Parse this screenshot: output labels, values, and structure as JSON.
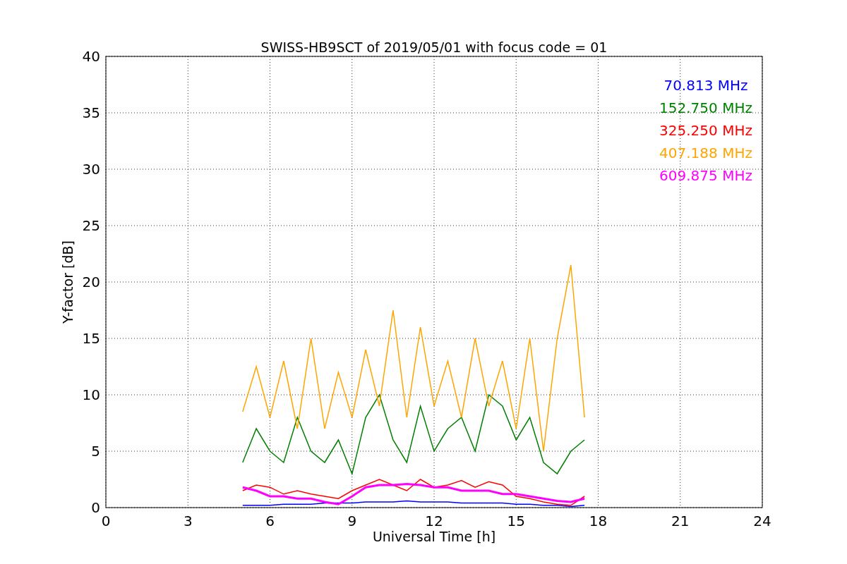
{
  "chart_data": {
    "type": "line",
    "title": "SWISS-HB9SCT of 2019/05/01 with focus code = 01",
    "xlabel": "Universal Time [h]",
    "ylabel": "Y-factor [dB]",
    "x": [
      5,
      5.5,
      6,
      6.5,
      7,
      7.5,
      8,
      8.5,
      9,
      9.5,
      10,
      10.5,
      11,
      11.5,
      12,
      12.5,
      13,
      13.5,
      14,
      14.5,
      15,
      15.5,
      16,
      16.5,
      17,
      17.5
    ],
    "series": [
      {
        "name": "70.813 MHz",
        "color": "#0000ff",
        "values": [
          0.2,
          0.2,
          0.2,
          0.3,
          0.3,
          0.3,
          0.4,
          0.4,
          0.4,
          0.5,
          0.5,
          0.5,
          0.6,
          0.5,
          0.5,
          0.5,
          0.4,
          0.4,
          0.4,
          0.4,
          0.3,
          0.3,
          0.2,
          0.2,
          0.1,
          0.2
        ]
      },
      {
        "name": "152.750 MHz",
        "color": "#008000",
        "values": [
          4,
          7,
          5,
          4,
          8,
          5,
          4,
          6,
          3,
          8,
          10,
          6,
          4,
          9,
          5,
          7,
          8,
          5,
          10,
          9,
          6,
          8,
          4,
          3,
          5,
          6
        ]
      },
      {
        "name": "325.250 MHz",
        "color": "#ff0000",
        "values": [
          1.5,
          2,
          1.8,
          1.2,
          1.5,
          1.2,
          1,
          0.8,
          1.5,
          2,
          2.5,
          2,
          1.5,
          2.5,
          1.8,
          2,
          2.4,
          1.8,
          2.3,
          2,
          1,
          0.8,
          0.5,
          0.3,
          0.2,
          1
        ]
      },
      {
        "name": "407.188 MHz",
        "color": "#ffa500",
        "values": [
          8.5,
          12.5,
          8,
          13,
          7,
          15,
          7,
          12,
          8,
          14,
          9,
          17.5,
          8,
          16,
          9,
          13,
          8,
          15,
          9,
          13,
          7,
          15,
          5,
          15,
          21.5,
          8
        ]
      },
      {
        "name": "609.875 MHz",
        "color": "#ff00ff",
        "values": [
          1.8,
          1.5,
          1,
          1,
          0.8,
          0.8,
          0.5,
          0.3,
          1,
          1.8,
          2,
          2,
          2.1,
          2,
          1.8,
          1.8,
          1.5,
          1.5,
          1.5,
          1.2,
          1.2,
          1,
          0.8,
          0.6,
          0.5,
          0.8
        ]
      }
    ],
    "xlim": [
      0,
      24
    ],
    "ylim": [
      0,
      40
    ],
    "xticks": [
      0,
      3,
      6,
      9,
      12,
      15,
      18,
      21,
      24
    ],
    "yticks": [
      0,
      5,
      10,
      15,
      20,
      25,
      30,
      35,
      40
    ],
    "grid": true
  }
}
